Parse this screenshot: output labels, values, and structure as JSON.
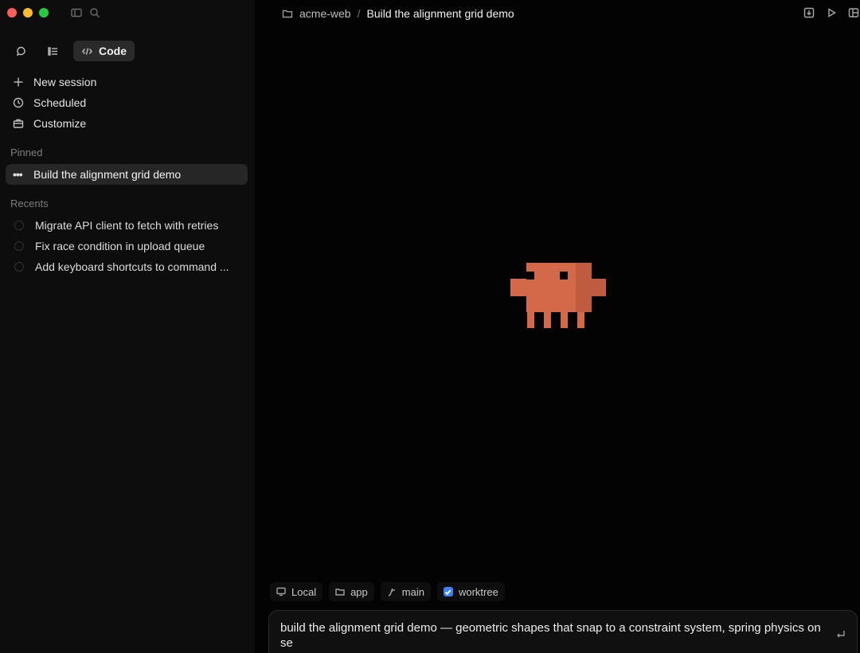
{
  "sidebar": {
    "mode_label": "Code",
    "nav": [
      {
        "label": "New session",
        "icon": "plus-icon"
      },
      {
        "label": "Scheduled",
        "icon": "clock-icon"
      },
      {
        "label": "Customize",
        "icon": "briefcase-icon"
      }
    ],
    "pinned_label": "Pinned",
    "pinned": [
      {
        "label": "Build the alignment grid demo"
      }
    ],
    "recents_label": "Recents",
    "recents": [
      {
        "label": "Migrate API client to fetch with retries"
      },
      {
        "label": "Fix race condition in upload queue"
      },
      {
        "label": "Add keyboard shortcuts to command ..."
      }
    ]
  },
  "header": {
    "project": "acme-web",
    "separator": "/",
    "title": "Build the alignment grid demo"
  },
  "chips": {
    "local": "Local",
    "folder": "app",
    "branch": "main",
    "worktree": "worktree"
  },
  "composer": {
    "text": "build the alignment grid demo — geometric shapes that snap to a constraint system, spring physics on se"
  },
  "colors": {
    "accent": "#3b82f6",
    "mascot": "#d4694a",
    "mascot_shade": "#bf5c40"
  }
}
